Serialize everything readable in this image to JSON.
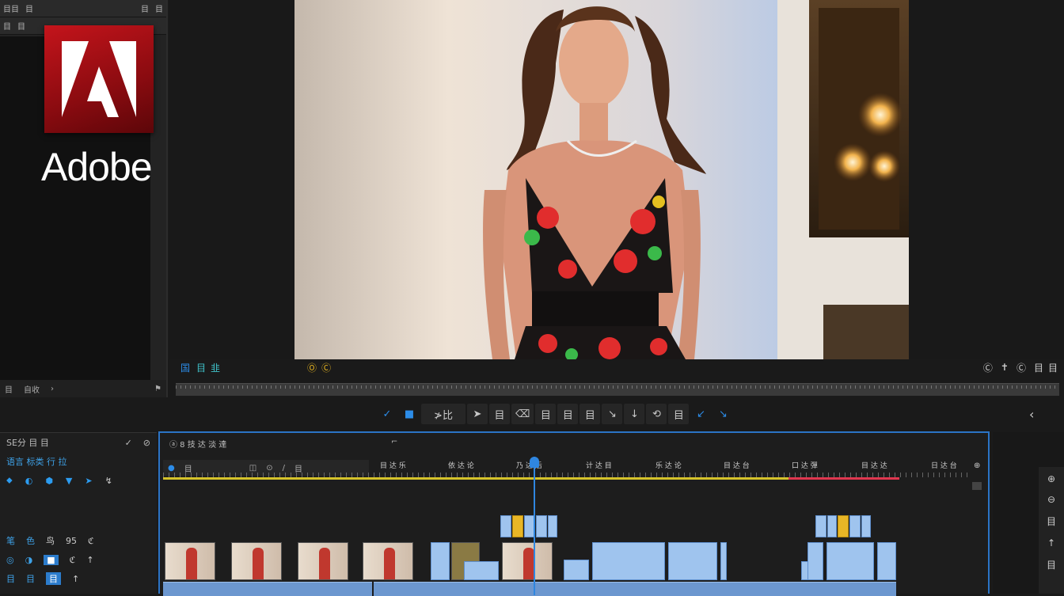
{
  "project_panel": {
    "top_bar_items": [
      "目目",
      "目",
      "目",
      "目"
    ],
    "second_bar_items": [
      "目",
      "目"
    ],
    "footer_items": [
      "目",
      "自收",
      "›",
      "⚑"
    ]
  },
  "logo": {
    "wordmark": "Adobe",
    "brand_color": "#c4141b"
  },
  "monitor": {
    "controls_left": [
      "国",
      "目",
      "韭"
    ],
    "controls_mid": [
      "Ⓞ",
      "Ⓒ"
    ],
    "controls_right": [
      "Ⓒ",
      "✝",
      "Ⓒ",
      "目",
      "目"
    ]
  },
  "toolbar": {
    "tools": [
      "✓",
      "■",
      "≯比",
      "➤",
      "目",
      "⌫",
      "目",
      "目",
      "目",
      "↘",
      "↓",
      "⟲",
      "目",
      "↙",
      "↘"
    ]
  },
  "tools_panel": {
    "header": "SE分 目 目",
    "subheader": "语言 标类 行 拉",
    "icon_row": [
      "⬥",
      "◐",
      "⬢",
      "▼",
      "➤",
      "↯"
    ],
    "track_rows": [
      [
        "笔",
        "色",
        "鸟",
        "95",
        "ℭ"
      ],
      [
        "◎",
        "◑",
        "■",
        "ℭ",
        "↑"
      ],
      [
        "目",
        "目",
        "目",
        "↑"
      ]
    ]
  },
  "timeline": {
    "title": "ⓐ 8 技 达 淡 達",
    "header_items": [
      "●",
      "目",
      "◫",
      "⊙",
      "/",
      "目"
    ],
    "ruler_labels": [
      "目 达 乐",
      "依 达 论",
      "乃 达 后",
      "计 达 目",
      "乐 达 论",
      "目 达 台",
      "口 达 彈",
      "目 达 达",
      "日 达 台"
    ],
    "accent_color": "#2b74c6"
  },
  "right_panel": {
    "icons": [
      "⊕",
      "⊖",
      "目",
      "↑",
      "目"
    ]
  }
}
